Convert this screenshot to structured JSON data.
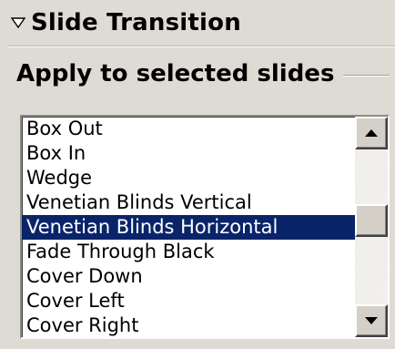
{
  "panel": {
    "title": "Slide Transition",
    "collapse_icon": "triangle-down-icon"
  },
  "apply_group": {
    "label": "Apply to selected slides"
  },
  "transitions": {
    "items": [
      "Box Out",
      "Box In",
      "Wedge",
      "Venetian Blinds Vertical",
      "Venetian Blinds Horizontal",
      "Fade Through Black",
      "Cover Down",
      "Cover Left",
      "Cover Right"
    ],
    "selected": "Venetian Blinds Horizontal",
    "scroll_up_icon": "arrow-up-icon",
    "scroll_down_icon": "arrow-down-icon"
  },
  "colors": {
    "selection_bg": "#0a246a",
    "selection_fg": "#ffffff",
    "panel_bg": "#dedbd4"
  }
}
